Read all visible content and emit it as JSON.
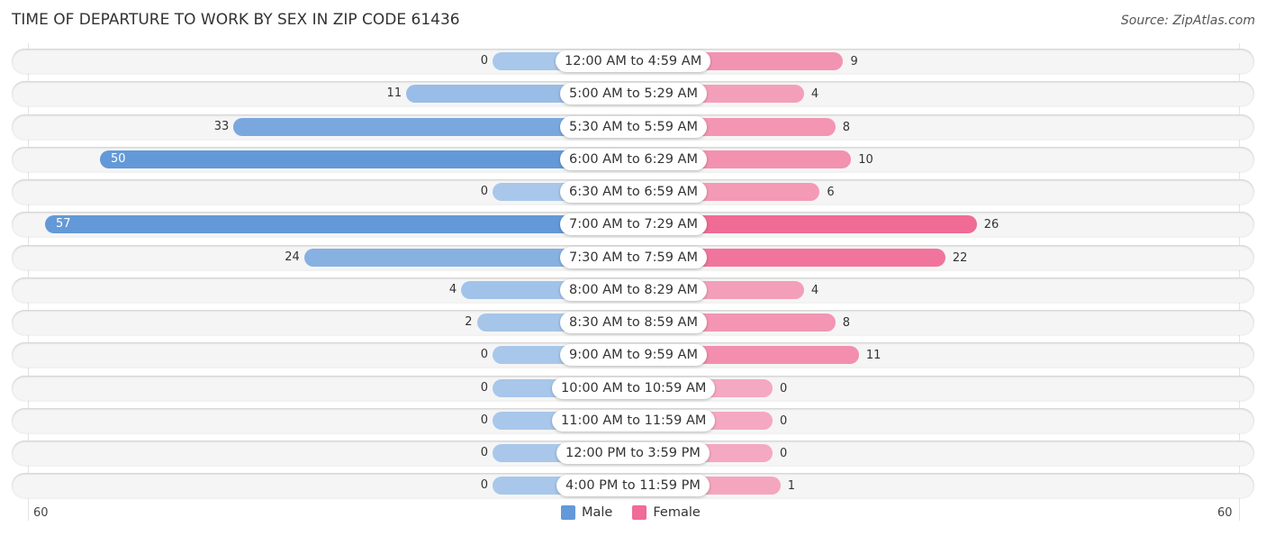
{
  "header": {
    "title": "TIME OF DEPARTURE TO WORK BY SEX IN ZIP CODE 61436",
    "source": "Source: ZipAtlas.com"
  },
  "colors": {
    "male_strong": "#6399d8",
    "male_light": "#a8c7ea",
    "female_strong": "#f06b95",
    "female_light": "#f5a8c1",
    "track": "#f5f5f5"
  },
  "chart_data": {
    "type": "bar",
    "orientation": "horizontal-diverging",
    "title": "TIME OF DEPARTURE TO WORK BY SEX IN ZIP CODE 61436",
    "categories": [
      "12:00 AM to 4:59 AM",
      "5:00 AM to 5:29 AM",
      "5:30 AM to 5:59 AM",
      "6:00 AM to 6:29 AM",
      "6:30 AM to 6:59 AM",
      "7:00 AM to 7:29 AM",
      "7:30 AM to 7:59 AM",
      "8:00 AM to 8:29 AM",
      "8:30 AM to 8:59 AM",
      "9:00 AM to 9:59 AM",
      "10:00 AM to 10:59 AM",
      "11:00 AM to 11:59 AM",
      "12:00 PM to 3:59 PM",
      "4:00 PM to 11:59 PM"
    ],
    "series": [
      {
        "name": "Male",
        "values": [
          0,
          11,
          33,
          50,
          0,
          57,
          24,
          4,
          2,
          0,
          0,
          0,
          0,
          0
        ]
      },
      {
        "name": "Female",
        "values": [
          9,
          4,
          8,
          10,
          6,
          26,
          22,
          4,
          8,
          11,
          0,
          0,
          0,
          1
        ]
      }
    ],
    "axis": {
      "left_max": 60,
      "right_max": 60,
      "left_tick_label": "60",
      "right_tick_label": "60"
    },
    "legend": {
      "position": "bottom-center",
      "entries": [
        "Male",
        "Female"
      ]
    },
    "xlabel": "",
    "ylabel": ""
  }
}
